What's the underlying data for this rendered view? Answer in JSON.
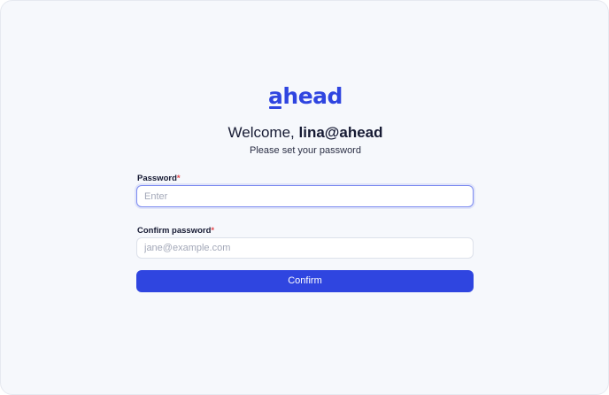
{
  "brand": {
    "logo_first_letter": "a",
    "logo_rest": "head",
    "accent_color": "#2f45e0"
  },
  "heading": {
    "welcome_prefix": "Welcome, ",
    "email": "lina@ahead",
    "subtitle": "Please set your password"
  },
  "form": {
    "password": {
      "label": "Password",
      "required_mark": "*",
      "value": "",
      "placeholder": "Enter",
      "focused": true
    },
    "confirm_password": {
      "label": "Confirm password",
      "required_mark": "*",
      "value": "",
      "placeholder": "jane@example.com"
    },
    "confirm_button_label": "Confirm"
  }
}
